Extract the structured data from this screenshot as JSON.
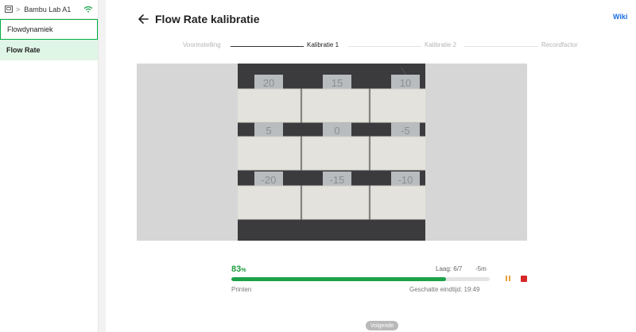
{
  "sidebar": {
    "breadcrumb_chevron": ">",
    "printer_name": "Bambu Lab A1",
    "items": [
      {
        "label": "Flowdynamiek"
      },
      {
        "label": "Flow Rate"
      }
    ]
  },
  "header": {
    "back_label": "←",
    "title": "Flow Rate kalibratie",
    "wiki": "Wiki"
  },
  "stepper": {
    "steps": [
      {
        "label": "Voorinstelling",
        "state": "done"
      },
      {
        "label": "Kalibratie 1",
        "state": "current"
      },
      {
        "label": "Kalibratie 2",
        "state": "pending"
      },
      {
        "label": "Recordfactor",
        "state": "pending"
      }
    ]
  },
  "photo": {
    "tiles": [
      "20",
      "15",
      "10",
      "5",
      "0",
      "-5",
      "-20",
      "-15",
      "-10"
    ]
  },
  "progress": {
    "percent_value": "83",
    "percent_unit": "%",
    "fraction": 0.83,
    "layer": "Laag: 6/7",
    "remaining": "-5m",
    "status": "Printen",
    "eta": "Geschatte eindtijd: 19:49"
  },
  "footer": {
    "next_label": "Volgende"
  },
  "colors": {
    "accent_green": "#1ca24a",
    "active_bg": "#dff5e5",
    "pause": "#e8a23a",
    "stop": "#d62828",
    "link": "#1a6ee0"
  }
}
